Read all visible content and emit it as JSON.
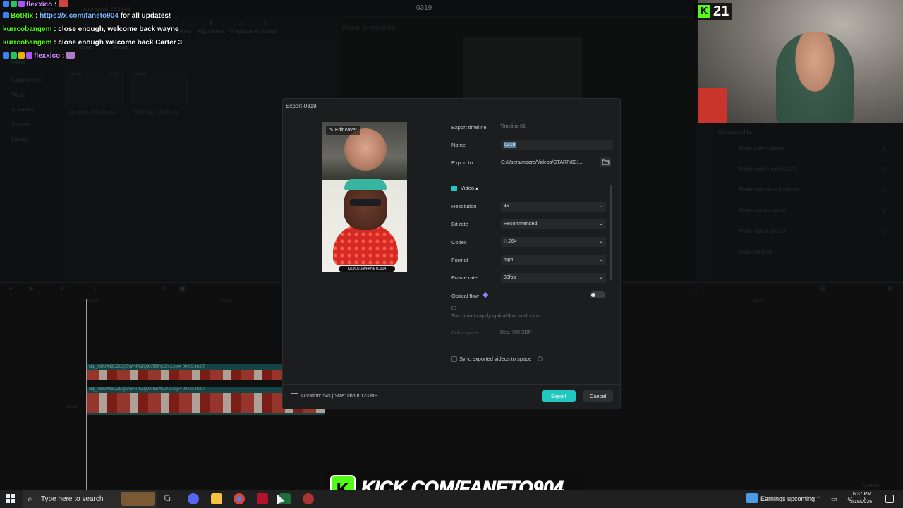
{
  "app": {
    "title": "0319",
    "autosave": "Auto saved: 18:35:49",
    "menu": "Menu",
    "tools": [
      "Filters",
      "Adjustment",
      "Templates",
      "AI avatar"
    ],
    "media_tabs": [
      "Import",
      "Record"
    ],
    "sidebar": [
      "Subprojects",
      "Yours",
      "AI media",
      "Spaces",
      "Library"
    ],
    "media_label": "Media",
    "clips": [
      {
        "badge": "Added",
        "duration": "00:00",
        "name": "clip_09KM...PISCN3.mp4"
      },
      {
        "badge": "Added",
        "duration": "",
        "name": "FANETO90...URCE.png"
      }
    ],
    "player_label": "Player-Timeline 01",
    "global_edits": {
      "title": "Global edits",
      "items": [
        "Make colors better",
        "Make colors consistent",
        "Make volume consistent",
        "Make voice clearer",
        "Make video clearer",
        "Retouch face"
      ]
    },
    "timeline": {
      "start": "00:00",
      "marks": [
        "00:00",
        "00:30",
        "01:00"
      ],
      "tracks": [
        {
          "label": "clip_09KM43DZCQGWHP6ZQ9KTEPGCN3.mp4   00:00:46:07"
        },
        {
          "label": "clip_09KM43DZCQGWHP6ZQ9KTEPGCN3.mp4   00:00:46:07"
        }
      ],
      "cover_label": "Cover",
      "ai_pilot": "EditPilot"
    }
  },
  "chat": [
    {
      "user": "flexxico",
      "sep": ":",
      "message": "",
      "user_color": "#d48cff"
    },
    {
      "user": "BotRix",
      "sep": ":",
      "message_link": "https://x.com/faneto904",
      "message": " for all updates!",
      "user_color": "#53fc18"
    },
    {
      "user": "kurrcobangem",
      "sep": ":",
      "message": " close enough, welcome back wayne",
      "user_color": "#53fc18"
    },
    {
      "user": "kurrcobangem",
      "sep": ":",
      "message": " close enough welcome back Carter 3",
      "user_color": "#53fc18"
    },
    {
      "user": "flexxico",
      "sep": ":",
      "message": "",
      "user_color": "#d48cff"
    }
  ],
  "stream": {
    "viewer_count": "21",
    "banner": "KICK.COM/FANETO904",
    "cover_watermark": "KICK.COM/FANETO904"
  },
  "export": {
    "window_title": "Export-0319",
    "edit_cover": "Edit cover",
    "export_timeline_label": "Export timeline",
    "export_timeline_value": "Timeline 01",
    "name_label": "Name",
    "name_value": "0319",
    "export_to_label": "Export to",
    "export_to_value": "C:/Users/moore/Videos/GTARP/031...",
    "video_section": "Video",
    "resolution_label": "Resolution",
    "resolution_value": "4K",
    "bitrate_label": "Bit rate",
    "bitrate_value": "Recommended",
    "codec_label": "Codec",
    "codec_value": "H.264",
    "format_label": "Format",
    "format_value": "mp4",
    "framerate_label": "Frame rate",
    "framerate_value": "30fps",
    "optical_flow_label": "Optical flow",
    "optical_flow_on": false,
    "optical_flow_desc": "Turn it on to apply optical flow to all clips.",
    "color_space_label": "Color space",
    "color_space_value": "Rec. 709 SDR",
    "sync_label": "Sync exported videos to space",
    "duration": "Duration: 54s | Size: about 123 MB",
    "export_button": "Export",
    "cancel_button": "Cancel"
  },
  "taskbar": {
    "search_placeholder": "Type here to search",
    "weather": "Earnings upcoming",
    "time": "6:37 PM",
    "date": "3/19/2026"
  },
  "colors": {
    "accent": "#22c8c0",
    "kick_green": "#53fc18"
  }
}
